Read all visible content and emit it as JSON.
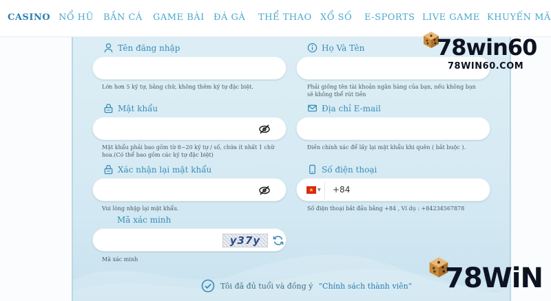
{
  "nav": {
    "items": [
      "CASINO",
      "NỔ HŨ",
      "BẮN CÁ",
      "GAME BÀI",
      "ĐÁ GÀ",
      "THỂ THAO",
      "XỔ SỐ",
      "E-SPORTS",
      "LIVE GAME",
      "KHUYẾN MÃI"
    ],
    "active_index": 0
  },
  "form": {
    "username": {
      "label": "Tên đăng nhập",
      "value": "",
      "hint": "Lớn hơn 5 ký tự, bằng chữ, không thêm ký tự đặc biệt."
    },
    "fullname": {
      "label": "Họ Và Tên",
      "value": "",
      "hint": "Phải giống tên tài khoản ngân hàng của bạn, nếu không bạn sẽ không thể rút tiền"
    },
    "password": {
      "label": "Mật khẩu",
      "value": "",
      "hint": "Mật khẩu phải bao gồm từ 8~20 ký tự / số, chứa ít nhất 1 chữ hoa.(Có thể bao gồm các ký tự đặc biệt)"
    },
    "email": {
      "label": "Địa chỉ E-mail",
      "value": "",
      "hint": "Điền chính xác để lấy lại mật khẩu khi quên ( bắt buộc )."
    },
    "confirm_password": {
      "label": "Xác nhận lại mật khẩu",
      "value": "",
      "hint": "Vui lòng nhập lại mật khẩu."
    },
    "phone": {
      "label": "Số điện thoại",
      "value": "+84",
      "hint": "Số điện thoại bắt đầu bằng +84 , Ví dụ : +84234567878",
      "country_flag": "vietnam-flag"
    },
    "captcha": {
      "label": "Mã xác minh",
      "value": "",
      "hint": "Mã xác minh",
      "image_text": "y37y"
    },
    "agree": {
      "text": "Tôi đã đủ tuổi và đồng ý",
      "link": "“Chính sách thành viên”"
    }
  },
  "branding": {
    "logo_top": {
      "main": "78win60",
      "sub": "78WIN60.COM"
    },
    "logo_bottom": {
      "main": "78WiN"
    }
  },
  "colors": {
    "accent": "#3a8cb8",
    "nav_text": "#4aa8cf",
    "panel_bg": "#d7ebf4",
    "logo": "#0e1322",
    "dice": "#c98a3a"
  }
}
